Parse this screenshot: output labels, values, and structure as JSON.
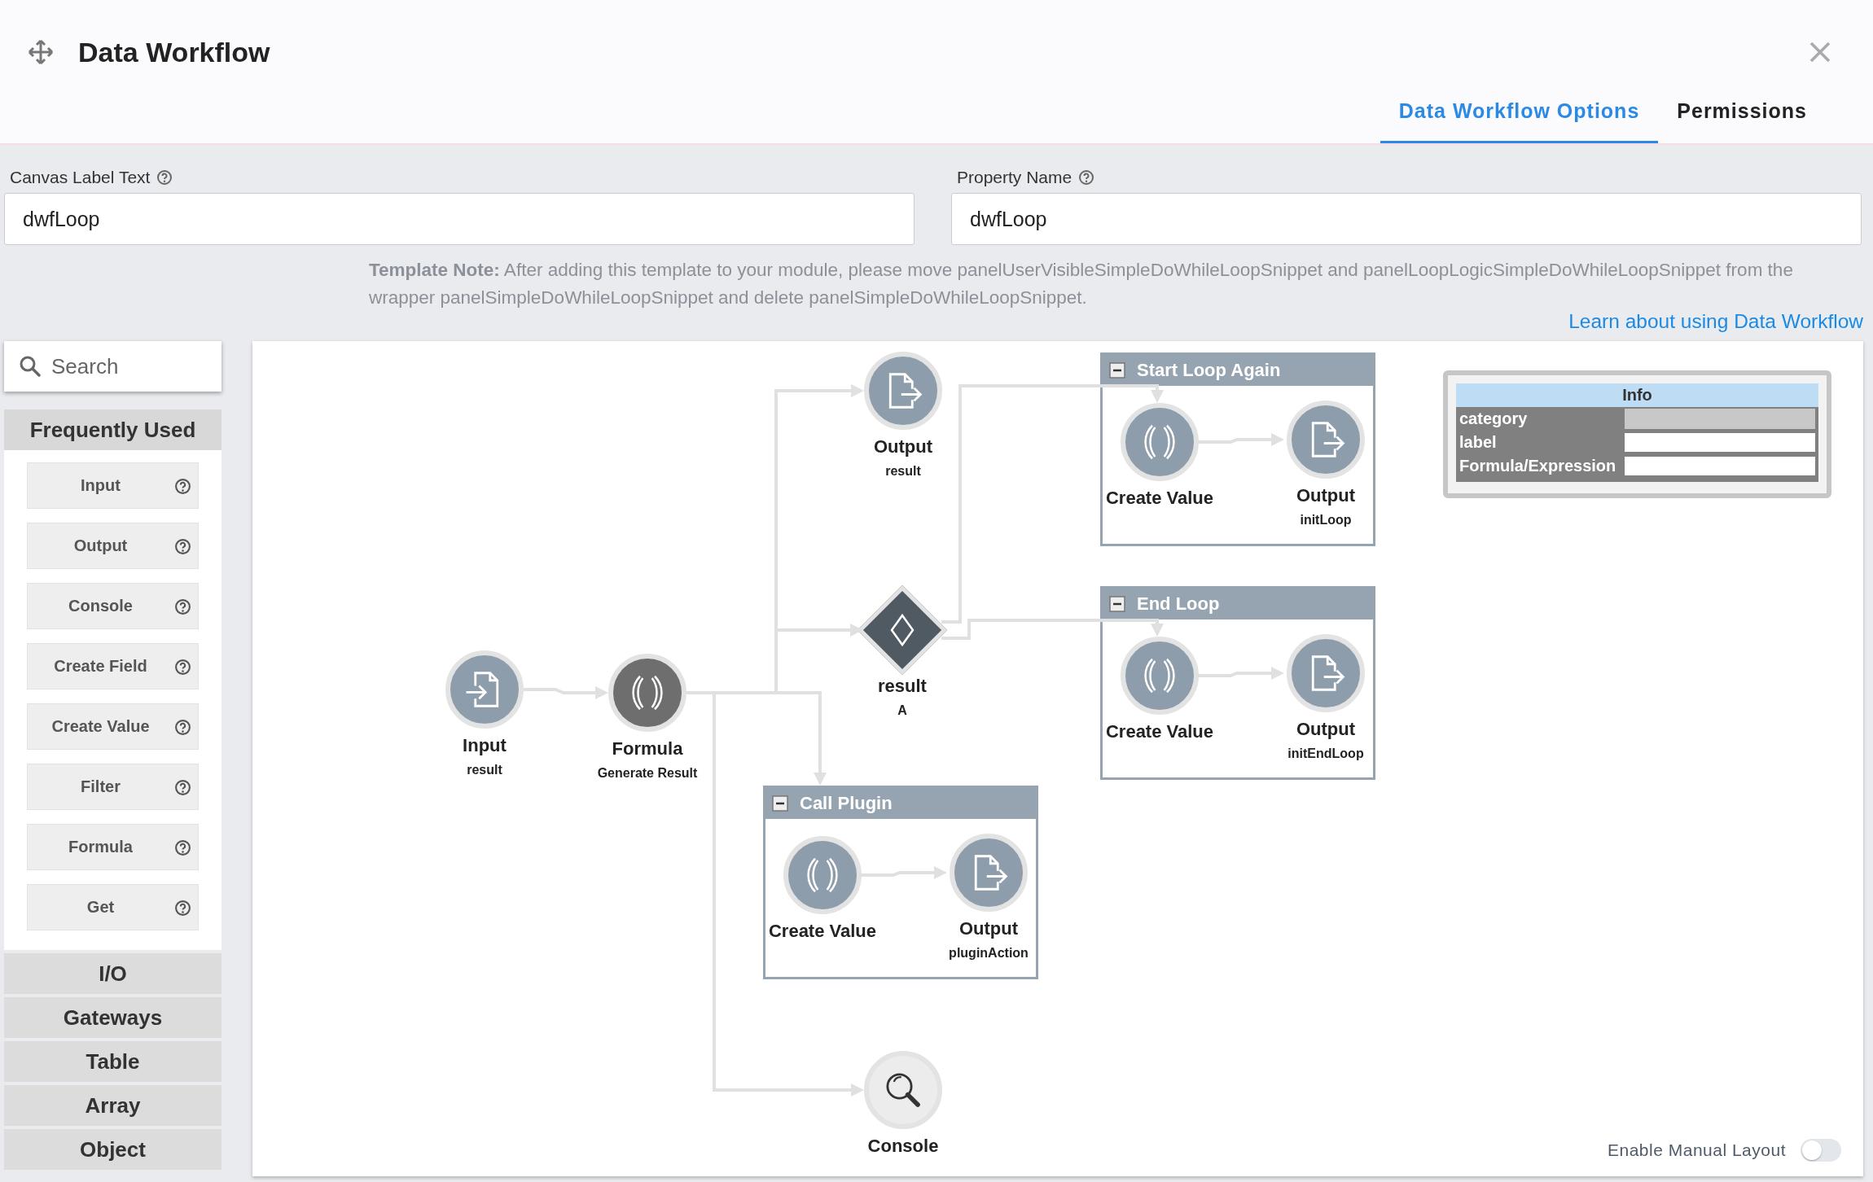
{
  "dialog": {
    "title": "Data Workflow"
  },
  "tabs": [
    {
      "label": "Data Workflow Options",
      "selected": true
    },
    {
      "label": "Permissions",
      "selected": false
    }
  ],
  "fields": [
    {
      "label": "Canvas Label Text",
      "value": "dwfLoop"
    },
    {
      "label": "Property Name",
      "value": "dwfLoop"
    }
  ],
  "template_note": "**Template Note:** After adding this template to your module, please move panelUserVisibleSimpleDoWhileLoopSnippet and panelLoopLogicSimpleDoWhileLoopSnippet from the wrapper panelSimpleDoWhileLoopSnippet and delete panelSimpleDoWhileLoopSnippet.",
  "learn_link": "Learn about using Data Workflow",
  "sidebar": {
    "search": {
      "placeholder": "Search"
    },
    "sections": [
      {
        "title": "Frequently Used",
        "expanded": true,
        "items": [
          "Input",
          "Output",
          "Console",
          "Create Field",
          "Create Value",
          "Filter",
          "Formula",
          "Get"
        ]
      },
      {
        "title": "I/O",
        "expanded": false
      },
      {
        "title": "Gateways",
        "expanded": false
      },
      {
        "title": "Table",
        "expanded": false
      },
      {
        "title": "Array",
        "expanded": false
      },
      {
        "title": "Object",
        "expanded": false
      }
    ]
  },
  "canvas": {
    "nodes": [
      {
        "kind": "input",
        "label": "Input",
        "sublabel": "result"
      },
      {
        "kind": "formula",
        "label": "Formula",
        "sublabel": "Generate Result"
      },
      {
        "kind": "output",
        "label": "Output",
        "sublabel": "result"
      },
      {
        "kind": "decision",
        "label": "result",
        "sublabel": "A"
      },
      {
        "kind": "console",
        "label": "Console"
      }
    ],
    "groups": [
      {
        "title": "Start Loop Again",
        "expanded": true,
        "nodes": [
          {
            "kind": "create_value",
            "label": "Create Value"
          },
          {
            "kind": "output",
            "label": "Output",
            "sublabel": "initLoop"
          }
        ]
      },
      {
        "title": "End Loop",
        "expanded": true,
        "nodes": [
          {
            "kind": "create_value",
            "label": "Create Value"
          },
          {
            "kind": "output",
            "label": "Output",
            "sublabel": "initEndLoop"
          }
        ]
      },
      {
        "title": "Call Plugin",
        "expanded": true,
        "nodes": [
          {
            "kind": "create_value",
            "label": "Create Value"
          },
          {
            "kind": "output",
            "label": "Output",
            "sublabel": "pluginAction"
          }
        ]
      }
    ],
    "info": {
      "title": "Info",
      "rows": [
        {
          "label": "category",
          "disabled": true
        },
        {
          "label": "label",
          "disabled": false
        },
        {
          "label": "Formula/Expression",
          "disabled": false
        }
      ]
    },
    "manual_layout": {
      "label": "Enable Manual Layout",
      "on": false
    }
  }
}
